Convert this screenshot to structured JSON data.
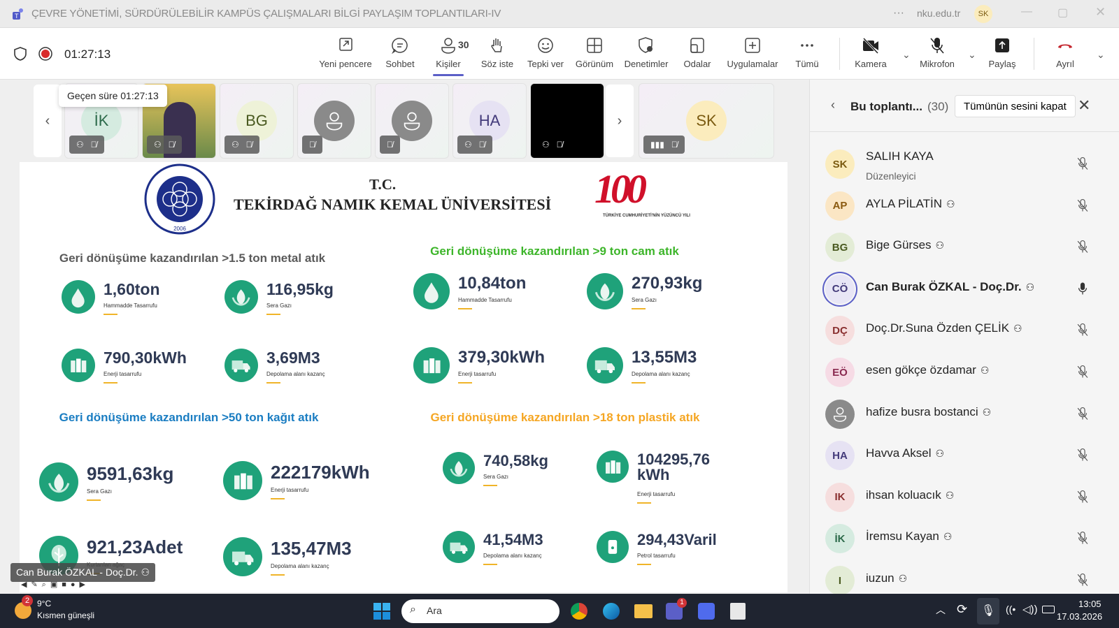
{
  "window": {
    "title": "ÇEVRE YÖNETİMİ, SÜRDÜRÜLEBİLİR KAMPÜS ÇALIŞMALARI BİLGİ PAYLAŞIM TOPLANTILARI-IV",
    "domain": "nku.edu.tr",
    "user_initials": "SK"
  },
  "meeting": {
    "timer": "01:27:13",
    "tooltip": "Geçen süre 01:27:13",
    "people_count": "30"
  },
  "toolbar": [
    {
      "label": "Yeni pencere",
      "icon": "popout-icon"
    },
    {
      "label": "Sohbet",
      "icon": "chat-icon"
    },
    {
      "label": "Kişiler",
      "icon": "people-icon"
    },
    {
      "label": "Söz iste",
      "icon": "raise-hand-icon"
    },
    {
      "label": "Tepki ver",
      "icon": "smile-icon"
    },
    {
      "label": "Görünüm",
      "icon": "grid-icon"
    },
    {
      "label": "Denetimler",
      "icon": "shield-gear-icon"
    },
    {
      "label": "Odalar",
      "icon": "rooms-icon"
    },
    {
      "label": "Uygulamalar",
      "icon": "plus-box-icon"
    },
    {
      "label": "Tümü",
      "icon": "more-icon"
    },
    {
      "label": "Kamera",
      "icon": "camera-off-icon"
    },
    {
      "label": "Mikrofon",
      "icon": "mic-off-icon"
    },
    {
      "label": "Paylaş",
      "icon": "share-icon"
    },
    {
      "label": "Ayrıl",
      "icon": "hangup-icon"
    }
  ],
  "tiles": [
    {
      "initials": "İK",
      "bg": "#d5ebe0",
      "color": "#2c6a4a"
    },
    {
      "initials": "",
      "video": true
    },
    {
      "initials": "BG",
      "bg": "#eef2d8",
      "color": "#4a5a20"
    },
    {
      "initials": "",
      "bg": "#8a8a8a",
      "generic": true
    },
    {
      "initials": "",
      "bg": "#8a8a8a",
      "generic": true
    },
    {
      "initials": "HA",
      "bg": "#e6e2f3",
      "color": "#433a7a"
    },
    {
      "initials": "",
      "black": true
    },
    {
      "initials": "SK",
      "bg": "#fbecbd",
      "color": "#7a5a10"
    }
  ],
  "slide": {
    "tc": "T.C.",
    "university": "TEKİRDAĞ NAMIK KEMAL ÜNİVERSİTESİ",
    "logo_year": "2006",
    "logo_text": "NAMIK KEMAL ÜNİVERSİTESİ",
    "centennial": "100",
    "centennial_sub": "TÜRKİYE CUMHURİYETİ'NİN YÜZÜNCÜ YILI",
    "sections": [
      {
        "title": "Geri dönüşüme kazandırılan >1.5 ton metal atık",
        "color": "#5a5a5a",
        "stats": [
          {
            "value": "1,60ton",
            "label": "Hammadde Tasarrufu",
            "icon": "drop-icon"
          },
          {
            "value": "116,95kg",
            "label": "Sera Gazı",
            "icon": "leaf-icon"
          },
          {
            "value": "790,30kWh",
            "label": "Enerji tasarrufu",
            "icon": "battery-icon"
          },
          {
            "value": "3,69M3",
            "label": "Depolama alanı kazanç",
            "icon": "truck-icon"
          }
        ]
      },
      {
        "title": "Geri dönüşüme kazandırılan >9 ton cam atık",
        "color": "#3db52a",
        "stats": [
          {
            "value": "10,84ton",
            "label": "Hammadde Tasarrufu",
            "icon": "drop-icon"
          },
          {
            "value": "270,93kg",
            "label": "Sera Gazı",
            "icon": "leaf-icon"
          },
          {
            "value": "379,30kWh",
            "label": "Enerji tasarrufu",
            "icon": "battery-icon"
          },
          {
            "value": "13,55M3",
            "label": "Depolama alanı kazanç",
            "icon": "truck-icon"
          }
        ]
      },
      {
        "title": "Geri dönüşüme kazandırılan >50 ton kağıt atık",
        "color": "#1a7dc2",
        "stats": [
          {
            "value": "9591,63kg",
            "label": "Sera Gazı",
            "icon": "leaf-icon"
          },
          {
            "value": "222179kWh",
            "label": "Enerji tasarrufu",
            "icon": "battery-icon"
          },
          {
            "value": "921,23Adet",
            "label": "Kurtarılan ağaç",
            "icon": "tree-icon"
          },
          {
            "value": "135,47M3",
            "label": "Depolama alanı kazanç",
            "icon": "truck-icon"
          }
        ]
      },
      {
        "title": "Geri dönüşüme kazandırılan >18 ton plastik atık",
        "color": "#f5a623",
        "stats": [
          {
            "value": "740,58kg",
            "label": "Sera Gazı",
            "icon": "leaf-icon"
          },
          {
            "value": "104295,76 kWh",
            "label": "Enerji tasarrufu",
            "icon": "battery-icon"
          },
          {
            "value": "41,54M3",
            "label": "Depolama alanı kazanç",
            "icon": "truck-icon"
          },
          {
            "value": "294,43Varil",
            "label": "Petrol tasarrufu",
            "icon": "barrel-icon"
          }
        ]
      }
    ]
  },
  "presenter": "Can Burak ÖZKAL - Doç.Dr.",
  "panel": {
    "title": "Bu toplantı...",
    "count": "(30)",
    "mute_all": "Tümünün sesini kapat",
    "participants": [
      {
        "initials": "SK",
        "name": "SALIH KAYA",
        "role": "Düzenleyici",
        "bg": "#fbecbd",
        "color": "#7a5a10",
        "mic": "off"
      },
      {
        "initials": "AP",
        "name": "AYLA PİLATİN",
        "bg": "#fbe6c4",
        "color": "#8a5a10",
        "mic": "off",
        "unverified": true
      },
      {
        "initials": "BG",
        "name": "Bige Gürses",
        "bg": "#e3ecd6",
        "color": "#4a5a20",
        "mic": "off",
        "unverified": true
      },
      {
        "initials": "CÖ",
        "name": "Can Burak ÖZKAL - Doç.Dr.",
        "bg": "#e8e6f6",
        "color": "#433a7a",
        "mic": "on",
        "unverified": true,
        "speaking": true
      },
      {
        "initials": "DÇ",
        "name": "Doç.Dr.Suna Özden ÇELİK",
        "bg": "#f6dede",
        "color": "#8a3030",
        "mic": "off",
        "unverified": true
      },
      {
        "initials": "EÖ",
        "name": "esen gökçe özdamar",
        "bg": "#f6dbe5",
        "color": "#8a2a50",
        "mic": "off",
        "unverified": true
      },
      {
        "initials": "",
        "name": "hafize busra bostanci",
        "bg": "#8a8a8a",
        "color": "#fff",
        "mic": "off",
        "unverified": true,
        "generic": true
      },
      {
        "initials": "HA",
        "name": "Havva Aksel",
        "bg": "#e6e2f3",
        "color": "#433a7a",
        "mic": "off",
        "unverified": true
      },
      {
        "initials": "IK",
        "name": "ihsan koluacık",
        "bg": "#f6dede",
        "color": "#8a3030",
        "mic": "off",
        "unverified": true
      },
      {
        "initials": "İK",
        "name": "İremsu Kayan",
        "bg": "#d5ebe0",
        "color": "#2c6a4a",
        "mic": "off",
        "unverified": true
      },
      {
        "initials": "I",
        "name": "iuzun",
        "bg": "#e3ecd6",
        "color": "#4a5a20",
        "mic": "off",
        "unverified": true
      }
    ]
  },
  "taskbar": {
    "weather_badge": "2",
    "temp": "9°C",
    "weather": "Kısmen güneşli",
    "search": "Ara",
    "teams_badge": "1",
    "time": "13:05",
    "date": "17.03.2026"
  }
}
